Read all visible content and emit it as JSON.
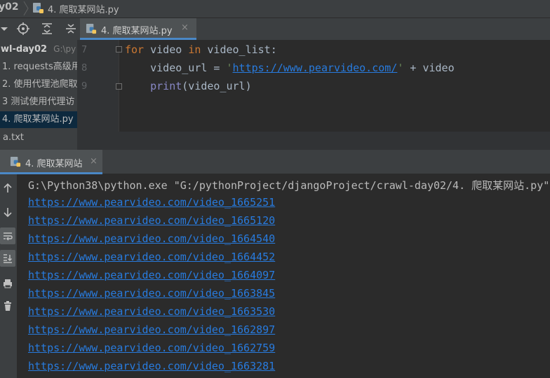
{
  "breadcrumb": {
    "project": "y02",
    "file": "4. 爬取某网站.py"
  },
  "project_panel": {
    "root_name": "wl-day02",
    "root_path": "G:\\py",
    "items": [
      {
        "label": "1. requests高级用"
      },
      {
        "label": "2. 使用代理池爬取"
      },
      {
        "label": "3 测试使用代理访"
      },
      {
        "label": "4. 爬取某网站.py"
      },
      {
        "label": "a.txt"
      }
    ]
  },
  "editor": {
    "tab_label": "4. 爬取某网站.py",
    "tab_close": "×",
    "lines": [
      {
        "no": "7",
        "kw": "for",
        "t1": " video ",
        "kw2": "in",
        "t2": " video_list:"
      },
      {
        "no": "8",
        "pre": "    video_url = ",
        "q1": "'",
        "url": "https://www.pearvideo.com/",
        "q2": "'",
        "post": " + video"
      },
      {
        "no": "9",
        "pre": "    ",
        "fn": "print",
        "post": "(video_url)"
      }
    ]
  },
  "run": {
    "tab_label": "4. 爬取某网站",
    "tab_close": "×",
    "command": "G:\\Python38\\python.exe \"G:/pythonProject/djangoProject/crawl-day02/4. 爬取某网站.py\"",
    "output": [
      "https://www.pearvideo.com/video_1665251",
      "https://www.pearvideo.com/video_1665120",
      "https://www.pearvideo.com/video_1664540",
      "https://www.pearvideo.com/video_1664452",
      "https://www.pearvideo.com/video_1664097",
      "https://www.pearvideo.com/video_1663845",
      "https://www.pearvideo.com/video_1663530",
      "https://www.pearvideo.com/video_1662897",
      "https://www.pearvideo.com/video_1662759",
      "https://www.pearvideo.com/video_1663281"
    ]
  },
  "colors": {
    "keyword": "#cc7832",
    "string": "#6a8759",
    "link": "#287bde",
    "builtin": "#8888c6",
    "selection": "#0d293e",
    "accent": "#4a88c7"
  },
  "icons": {
    "project_toolbar": [
      "collapse-arrow-icon",
      "locate-target-icon",
      "expand-all-icon",
      "collapse-all-icon"
    ],
    "run_toolbar": [
      "scroll-up-icon",
      "scroll-down-icon",
      "soft-wrap-icon",
      "scroll-to-end-icon",
      "print-icon",
      "trash-icon"
    ],
    "file": "python-file-icon"
  }
}
